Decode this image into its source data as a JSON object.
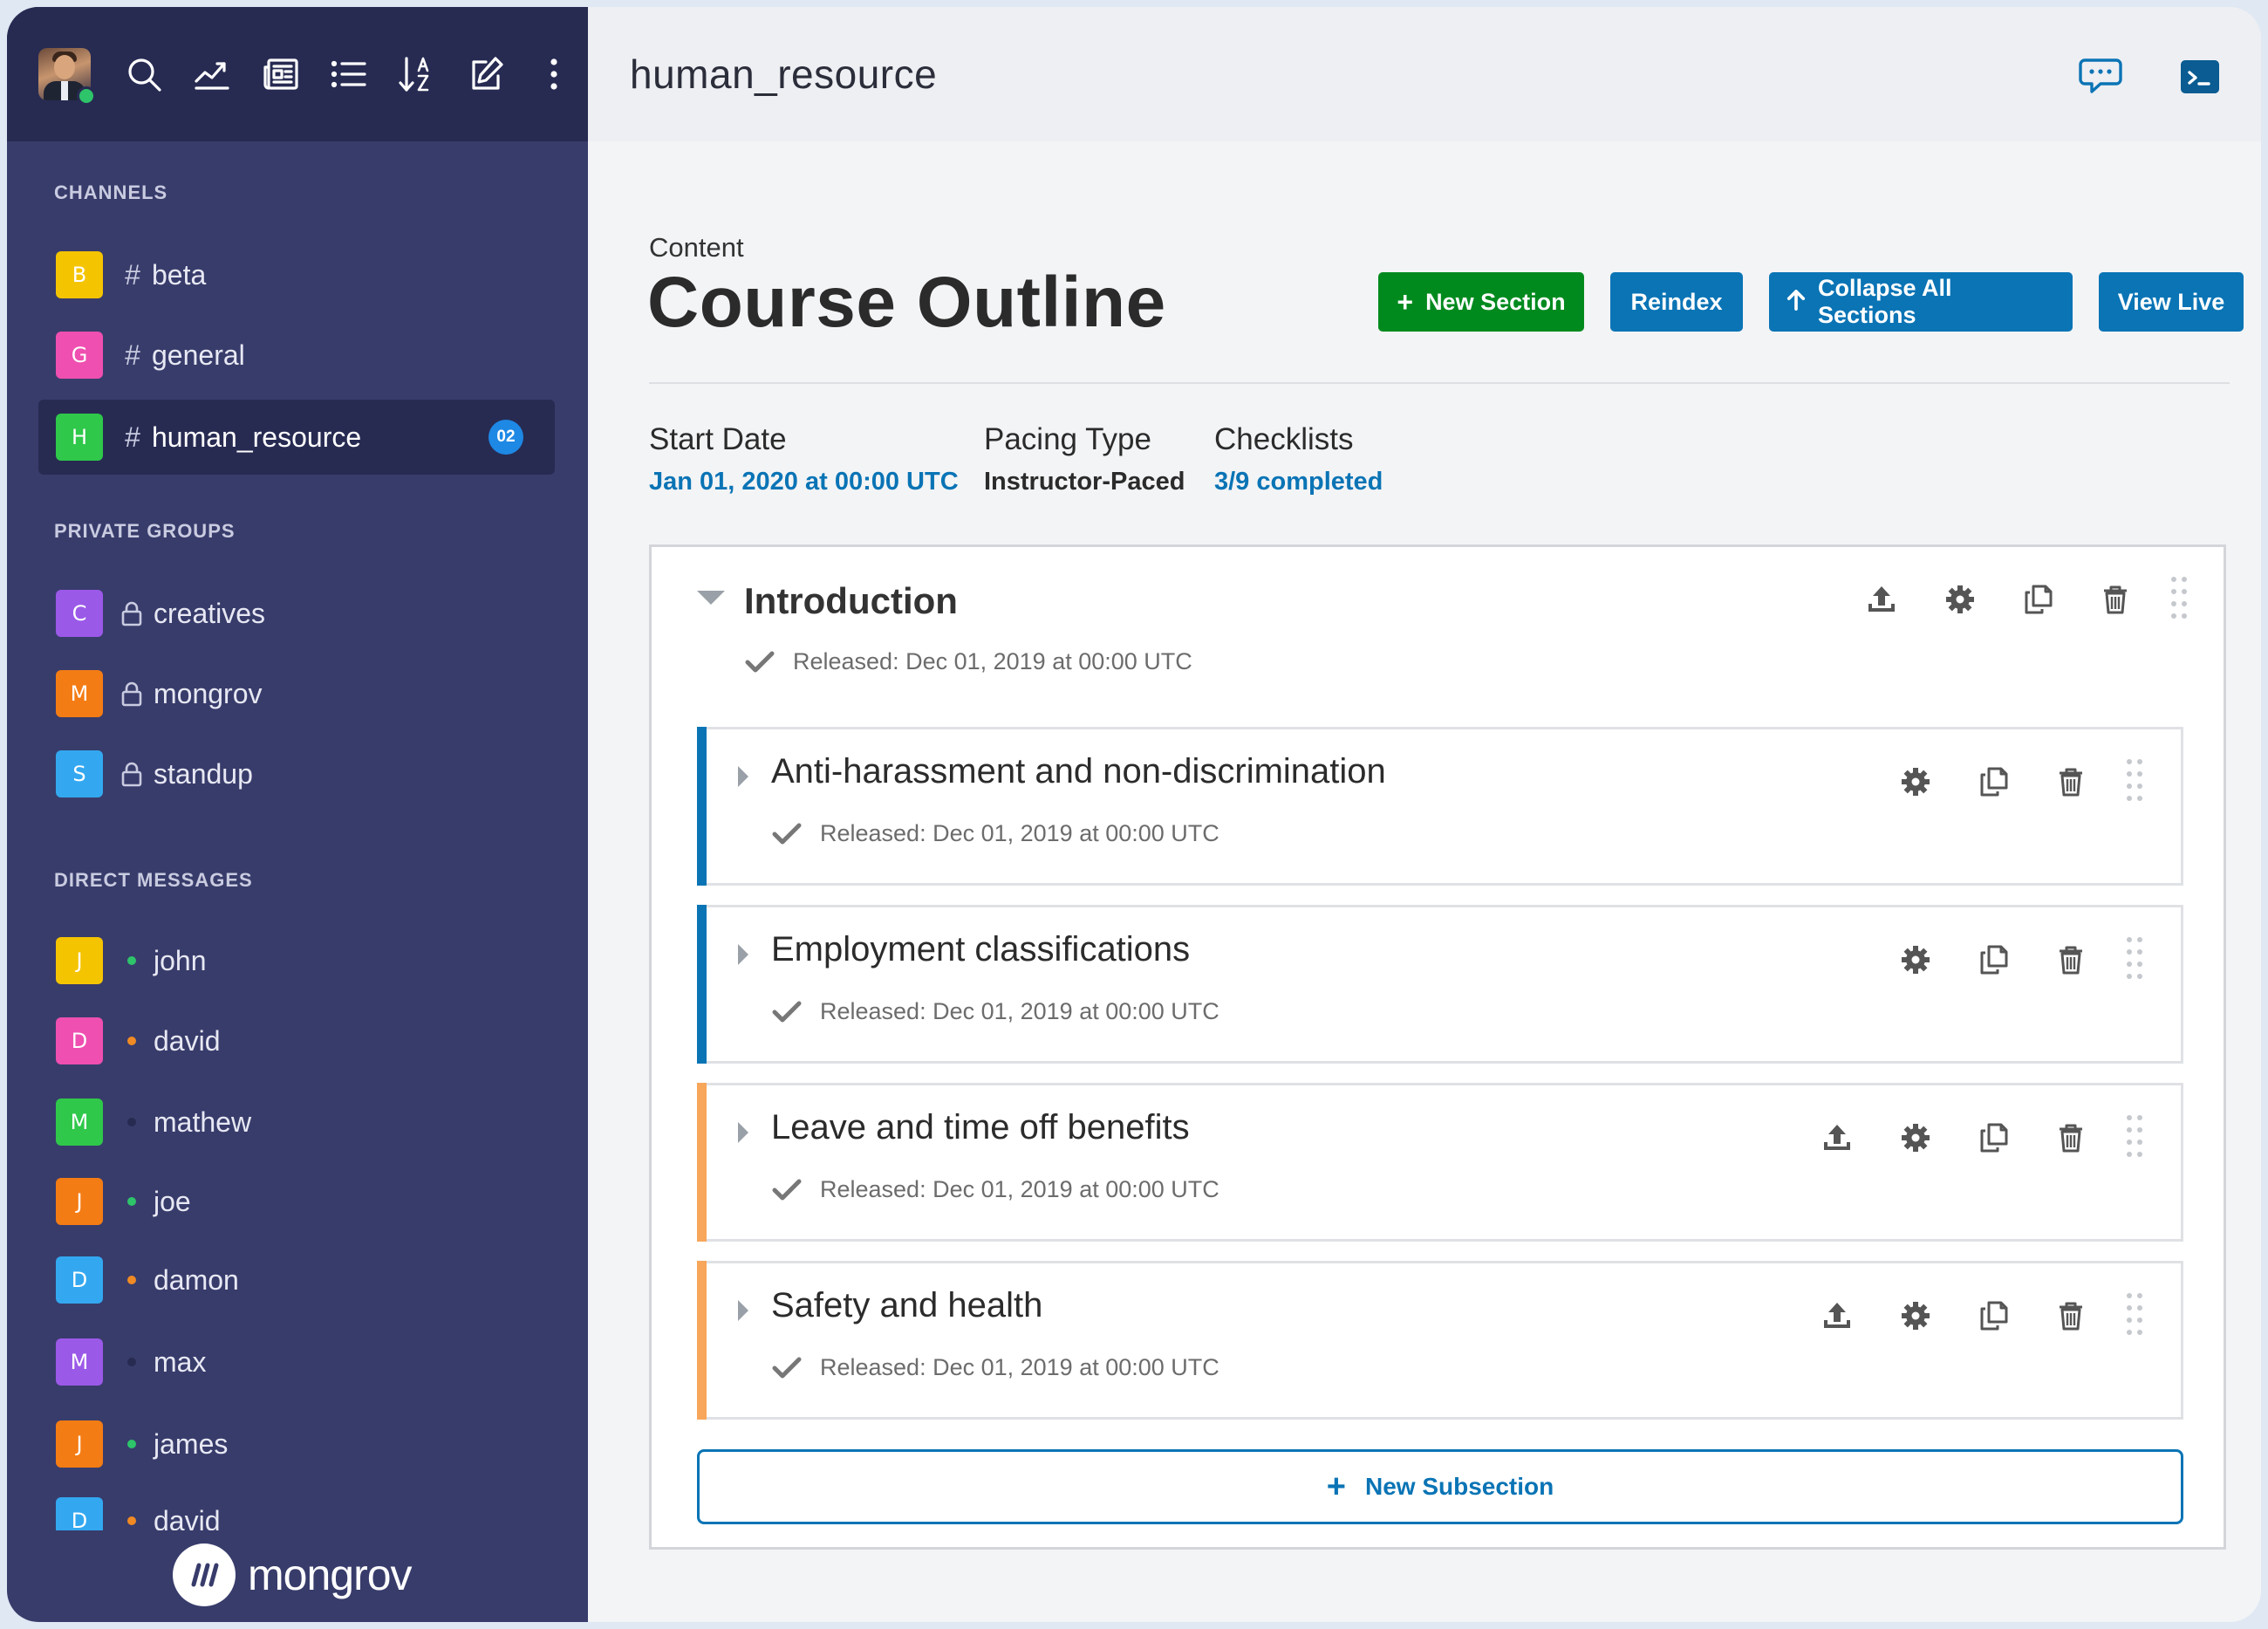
{
  "sidebar": {
    "sections": {
      "channels": "CHANNELS",
      "private_groups": "PRIVATE GROUPS",
      "direct_messages": "DIRECT MESSAGES"
    },
    "channels": [
      {
        "letter": "B",
        "name": "beta",
        "color": "#f5c400"
      },
      {
        "letter": "G",
        "name": "general",
        "color": "#ef4fb0"
      },
      {
        "letter": "H",
        "name": "human_resource",
        "color": "#2fc84a",
        "unread": "02"
      }
    ],
    "groups": [
      {
        "letter": "C",
        "name": "creatives",
        "color": "#9b59e8"
      },
      {
        "letter": "M",
        "name": "mongrov",
        "color": "#f47c14"
      },
      {
        "letter": "S",
        "name": "standup",
        "color": "#33a8f0"
      }
    ],
    "dms": [
      {
        "letter": "J",
        "name": "john",
        "color": "#f5c400",
        "status": "#2ec46a"
      },
      {
        "letter": "D",
        "name": "david",
        "color": "#ef4fb0",
        "status": "#f08a24"
      },
      {
        "letter": "M",
        "name": "mathew",
        "color": "#2fc84a",
        "status": "#272b52"
      },
      {
        "letter": "J",
        "name": "joe",
        "color": "#f47c14",
        "status": "#2ec46a"
      },
      {
        "letter": "D",
        "name": "damon",
        "color": "#33a8f0",
        "status": "#f08a24"
      },
      {
        "letter": "M",
        "name": "max",
        "color": "#9b59e8",
        "status": "#272b52"
      },
      {
        "letter": "J",
        "name": "james",
        "color": "#f47c14",
        "status": "#2ec46a"
      },
      {
        "letter": "D",
        "name": "david",
        "color": "#33a8f0",
        "status": "#f08a24"
      }
    ],
    "brand": "mongrov"
  },
  "header": {
    "title": "human_resource"
  },
  "content": {
    "crumb": "Content",
    "title": "Course Outline",
    "buttons": {
      "new_section": "New Section",
      "reindex": "Reindex",
      "collapse_all": "Collapse All Sections",
      "view_live": "View Live"
    },
    "meta": {
      "start_date_label": "Start Date",
      "start_date_value": "Jan 01, 2020 at 00:00 UTC",
      "pacing_label": "Pacing Type",
      "pacing_value": "Instructor-Paced",
      "checklists_label": "Checklists",
      "checklists_value": "3/9 completed"
    },
    "section": {
      "title": "Introduction",
      "released": "Released: Dec 01, 2019 at 00:00 UTC"
    },
    "subsections": [
      {
        "title": "Anti-harassment and non-discrimination",
        "released": "Released: Dec 01, 2019 at 00:00 UTC",
        "accent": "#0a74b5"
      },
      {
        "title": "Employment classifications",
        "released": "Released: Dec 01, 2019 at 00:00 UTC",
        "accent": "#0a74b5"
      },
      {
        "title": "Leave and time off benefits",
        "released": "Released: Dec 01, 2019 at 00:00 UTC",
        "accent": "#f7a65a"
      },
      {
        "title": "Safety and health",
        "released": "Released: Dec 01, 2019 at 00:00 UTC",
        "accent": "#f7a65a"
      }
    ],
    "new_subsection": "New Subsection"
  },
  "colors": {
    "green": "#008a1e",
    "blue": "#0a74b5",
    "sidebar": "#383c6b",
    "sidebar_dark": "#272b52"
  }
}
